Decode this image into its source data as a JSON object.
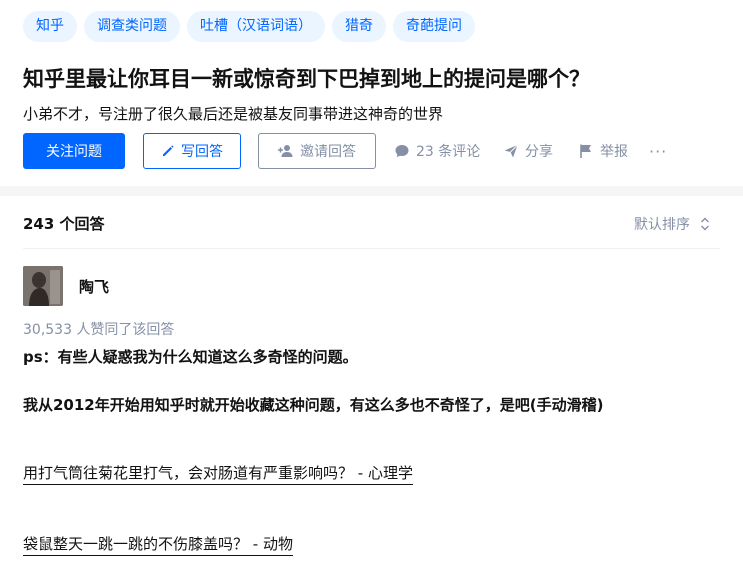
{
  "tags": [
    "知乎",
    "调查类问题",
    "吐槽（汉语词语）",
    "猎奇",
    "奇葩提问"
  ],
  "question": {
    "title": "知乎里最让你耳目一新或惊奇到下巴掉到地上的提问是哪个？",
    "description": "小弟不才，号注册了很久最后还是被基友同事带进这神奇的世界"
  },
  "actions": {
    "follow": "关注问题",
    "write": "写回答",
    "invite": "邀请回答",
    "comments": "23 条评论",
    "share": "分享",
    "report": "举报",
    "more": "···"
  },
  "answers": {
    "count_label": "243 个回答",
    "sort_label": "默认排序"
  },
  "answer": {
    "author": "陶飞",
    "votes": "30,533 人赞同了该回答",
    "line1": "ps：有些人疑惑我为什么知道这么多奇怪的问题。",
    "line2": "我从2012年开始用知乎时就开始收藏这种问题，有这么多也不奇怪了，是吧(手动滑稽)",
    "link1": "用打气筒往菊花里打气，会对肠道有严重影响吗？ - 心理学",
    "link2": "袋鼠整天一跳一跳的不伤膝盖吗？ - 动物"
  },
  "colors": {
    "brand": "#0066ff",
    "tag_bg": "#ebf5ff",
    "muted": "#8590a6"
  }
}
